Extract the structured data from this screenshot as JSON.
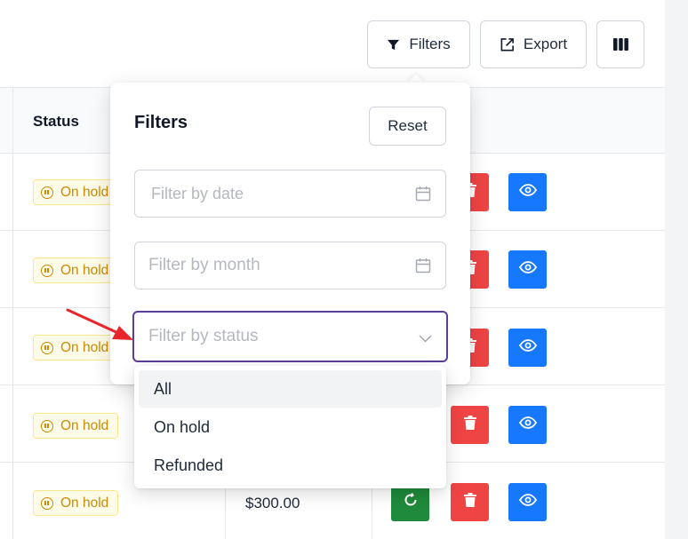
{
  "toolbar": {
    "filters_label": "Filters",
    "export_label": "Export"
  },
  "table": {
    "columns": {
      "status": "Status"
    },
    "rows": [
      {
        "status": "On hold",
        "amount": ""
      },
      {
        "status": "On hold",
        "amount": ""
      },
      {
        "status": "On hold",
        "amount": ""
      },
      {
        "status": "On hold",
        "amount": ""
      },
      {
        "status": "On hold",
        "amount": "$300.00"
      }
    ]
  },
  "filter_panel": {
    "title": "Filters",
    "reset_label": "Reset",
    "date_placeholder": "Filter by date",
    "month_placeholder": "Filter by month",
    "status_placeholder": "Filter by status",
    "status_options": [
      "All",
      "On hold",
      "Refunded"
    ]
  },
  "colors": {
    "accent_focus": "#5b3e96",
    "delete": "#ef4444",
    "view": "#1677ff",
    "refund": "#1f8a3b",
    "badge_text": "#ca8a04",
    "annotation_arrow": "#e8262b"
  },
  "icons": {
    "filters": "funnel-icon",
    "export": "export-icon",
    "columns": "columns-icon",
    "calendar": "calendar-icon",
    "dropdown": "chevron-down-icon",
    "delete": "trash-icon",
    "view": "eye-icon",
    "refund": "refresh-icon",
    "status": "pause-icon"
  }
}
